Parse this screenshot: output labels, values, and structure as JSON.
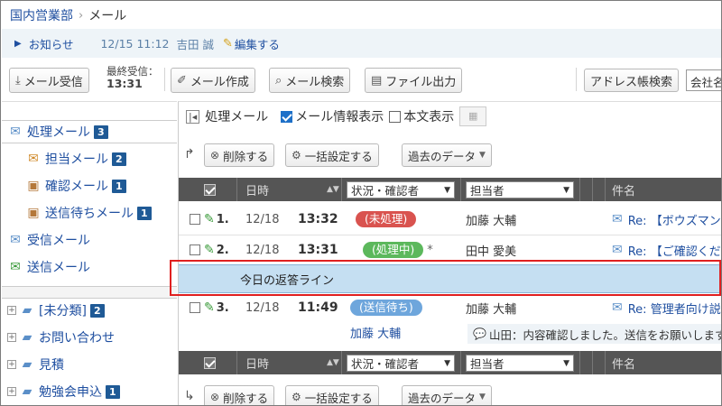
{
  "breadcrumb": {
    "parent": "国内営業部",
    "current": "メール"
  },
  "notice": {
    "title": "お知らせ",
    "date": "12/15 11:12",
    "author": "吉田 誠",
    "edit": "編集する"
  },
  "toolbar": {
    "receive": "メール受信",
    "last_received_label": "最終受信：",
    "last_received_time": "13:31",
    "compose": "メール作成",
    "search": "メール検索",
    "export": "ファイル出力",
    "address_search": "アドレス帳検索",
    "company_input": "会社名"
  },
  "sidebar": {
    "processing": {
      "label": "処理メール",
      "count": "3"
    },
    "assigned": {
      "label": "担当メール",
      "count": "2"
    },
    "confirm": {
      "label": "確認メール",
      "count": "1"
    },
    "awaiting": {
      "label": "送信待ちメール",
      "count": "1"
    },
    "inbox": {
      "label": "受信メール"
    },
    "sent": {
      "label": "送信メール"
    },
    "folders": [
      {
        "label": "[未分類]",
        "count": "2"
      },
      {
        "label": "お問い合わせ"
      },
      {
        "label": "見積"
      },
      {
        "label": "勉強会申込",
        "count": "1"
      }
    ]
  },
  "main": {
    "view_title": "処理メール",
    "show_info": "メール情報表示",
    "show_body": "本文表示",
    "delete": "削除する",
    "bulk": "一括設定する",
    "past_data": "過去のデータ",
    "header": {
      "datetime": "日時",
      "status": "状況・確認者",
      "assignee": "担当者",
      "subject": "件名"
    },
    "rows": [
      {
        "num": "1.",
        "date": "12/18",
        "time": "13:32",
        "status": "(未処理)",
        "assignee": "加藤 大輔",
        "subject": "Re: 【ボウズマン"
      },
      {
        "num": "2.",
        "date": "12/18",
        "time": "13:31",
        "status": "(処理中)",
        "star": "*",
        "assignee": "田中 愛美",
        "subject": "Re: 【ご確認くだ"
      },
      {
        "num": "3.",
        "date": "12/18",
        "time": "11:49",
        "status": "(送信待ち)",
        "assignee": "加藤 大輔",
        "subject": "Re: 管理者向け説"
      }
    ],
    "response_line": "今日の返答ライン",
    "row3_confirmer": "加藤 大輔",
    "row3_comment": "山田：内容確認しました。送信をお願いします。"
  },
  "colors": {
    "accent": "#1f4fa0",
    "status_unprocessed": "#d9534f",
    "status_processing": "#5cb85c",
    "status_waiting": "#6ea6dc",
    "response_line": "#c5dff2",
    "highlight_frame": "#e02020"
  }
}
